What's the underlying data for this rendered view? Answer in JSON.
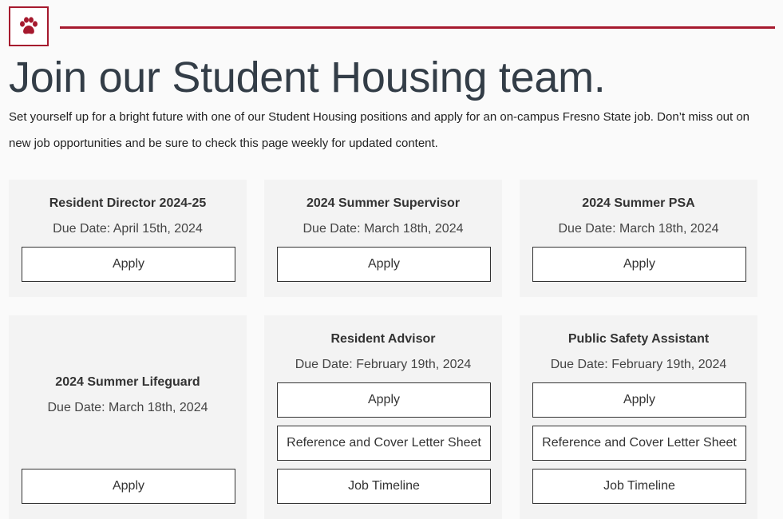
{
  "header": {
    "logo_icon": "paw-icon",
    "accent_color": "#a6192e"
  },
  "page_title": "Join our Student Housing team.",
  "intro": "Set yourself up for a bright future with one of our Student Housing positions and apply for an on-campus Fresno State job. Don’t miss out on new job opportunities and be sure to check this page weekly for updated content.",
  "cards": [
    {
      "title": "Resident Director 2024-25",
      "due": "Due Date: April 15th, 2024",
      "apply": "Apply"
    },
    {
      "title": "2024 Summer Supervisor",
      "due": "Due Date: March 18th, 2024",
      "apply": "Apply"
    },
    {
      "title": "2024 Summer PSA",
      "due": "Due Date: March 18th, 2024",
      "apply": "Apply"
    },
    {
      "title": "2024 Summer Lifeguard",
      "due": "Due Date: March 18th, 2024",
      "apply": "Apply"
    },
    {
      "title": "Resident Advisor",
      "due": "Due Date: February 19th, 2024",
      "apply": "Apply",
      "reference": "Reference and Cover Letter Sheet",
      "timeline": "Job Timeline"
    },
    {
      "title": "Public Safety Assistant",
      "due": "Due Date: February 19th, 2024",
      "apply": "Apply",
      "reference": "Reference and Cover Letter Sheet",
      "timeline": "Job Timeline"
    }
  ]
}
